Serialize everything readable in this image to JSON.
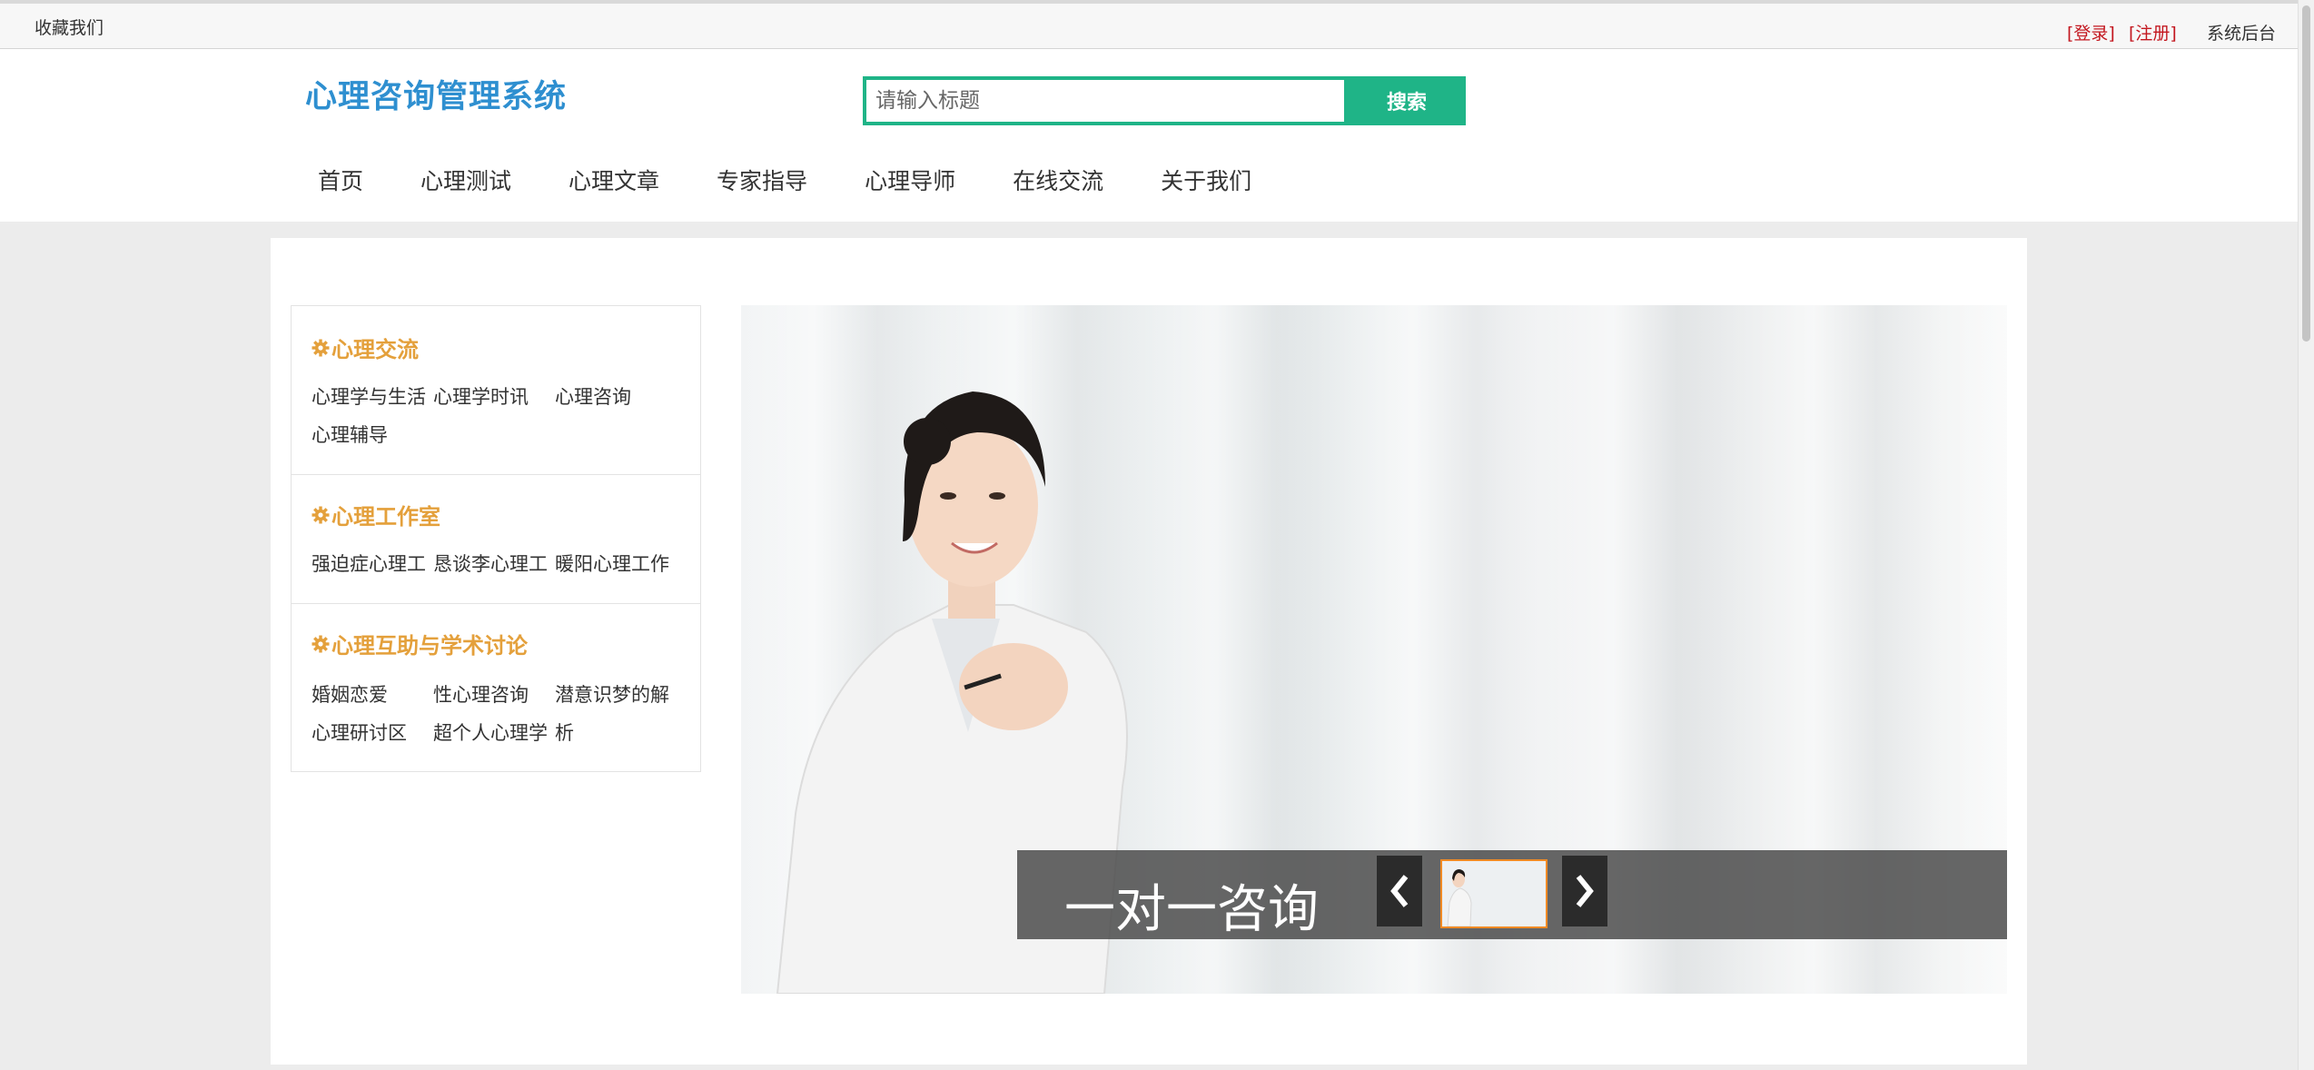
{
  "topbar": {
    "favorite": "收藏我们",
    "login": "[登录]",
    "register": "[注册]",
    "admin": "系统后台"
  },
  "header": {
    "brand": "心理咨询管理系统",
    "search_placeholder": "请输入标题",
    "search_button": "搜索"
  },
  "nav": [
    "首页",
    "心理测试",
    "心理文章",
    "专家指导",
    "心理导师",
    "在线交流",
    "关于我们"
  ],
  "sidebar": {
    "sections": [
      {
        "title": "心理交流",
        "rows": [
          [
            "心理学与生活",
            "心理学时讯",
            "心理咨询"
          ],
          [
            "心理辅导",
            "",
            ""
          ]
        ]
      },
      {
        "title": "心理工作室",
        "rows": [
          [
            "强迫症心理工",
            "恳谈李心理工",
            "暖阳心理工作"
          ]
        ]
      },
      {
        "title": "心理互助与学术讨论",
        "rows": [
          [
            "婚姻恋爱",
            "性心理咨询",
            "潜意识梦的解"
          ],
          [
            "心理研讨区",
            "超个人心理学",
            "析"
          ]
        ]
      }
    ]
  },
  "banner": {
    "caption": "一对一咨询"
  },
  "colors": {
    "accent_green": "#1fb487",
    "brand_blue": "#2e8fd0",
    "section_orange": "#e4a03b",
    "auth_red": "#c3171f",
    "thumb_border": "#f08a24"
  },
  "icons": [
    "gear-icon",
    "chevron-left-icon",
    "chevron-right-icon"
  ]
}
